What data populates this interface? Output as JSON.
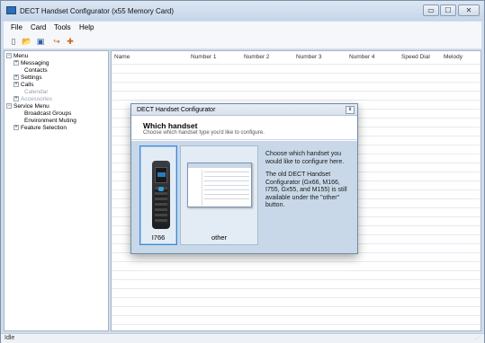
{
  "window": {
    "title": "DECT Handset Configurator (x55 Memory Card)",
    "controls": {
      "minimize": "▭",
      "maximize": "☐",
      "close": "✕"
    }
  },
  "menubar": [
    "File",
    "Card",
    "Tools",
    "Help"
  ],
  "toolbar": [
    {
      "icon": "new-doc-icon",
      "glyph": "▯"
    },
    {
      "icon": "open-folder-icon",
      "glyph": "📂"
    },
    {
      "icon": "save-icon",
      "glyph": "▣"
    },
    {
      "icon": "export-icon",
      "glyph": "↪"
    },
    {
      "icon": "import-icon",
      "glyph": "✚"
    }
  ],
  "tree": {
    "menu": "Menu",
    "messaging": "Messaging",
    "contacts": "Contacts",
    "settings": "Settings",
    "calls": "Calls",
    "calendar": "Calendar",
    "accessories": "Accessories",
    "service_menu": "Service Menu",
    "broadcast_groups": "Broadcast Groups",
    "environment_muting": "Environment Muting",
    "feature_selection": "Feature Selection"
  },
  "grid": {
    "columns": [
      "Name",
      "Number 1",
      "Number 2",
      "Number 3",
      "Number 4",
      "Speed Dial",
      "Melody"
    ]
  },
  "dialog": {
    "title": "DECT Handset Configurator",
    "close": "x",
    "heading": "Which handset",
    "subheading": "Choose which handset type you'd like to configure.",
    "option_a": "I766",
    "option_b": "other",
    "desc1": "Choose which handset you would like to configure here.",
    "desc2": "The old DECT Handset Configurator (Gx66, M166, I755, Gx55, and M155) is still available under the \"other\" button."
  },
  "status": {
    "text": "Idle"
  },
  "colors": {
    "accent": "#3b88d8",
    "dialog_body": "#c8d8e8",
    "window_chrome": "#cfdceb"
  }
}
